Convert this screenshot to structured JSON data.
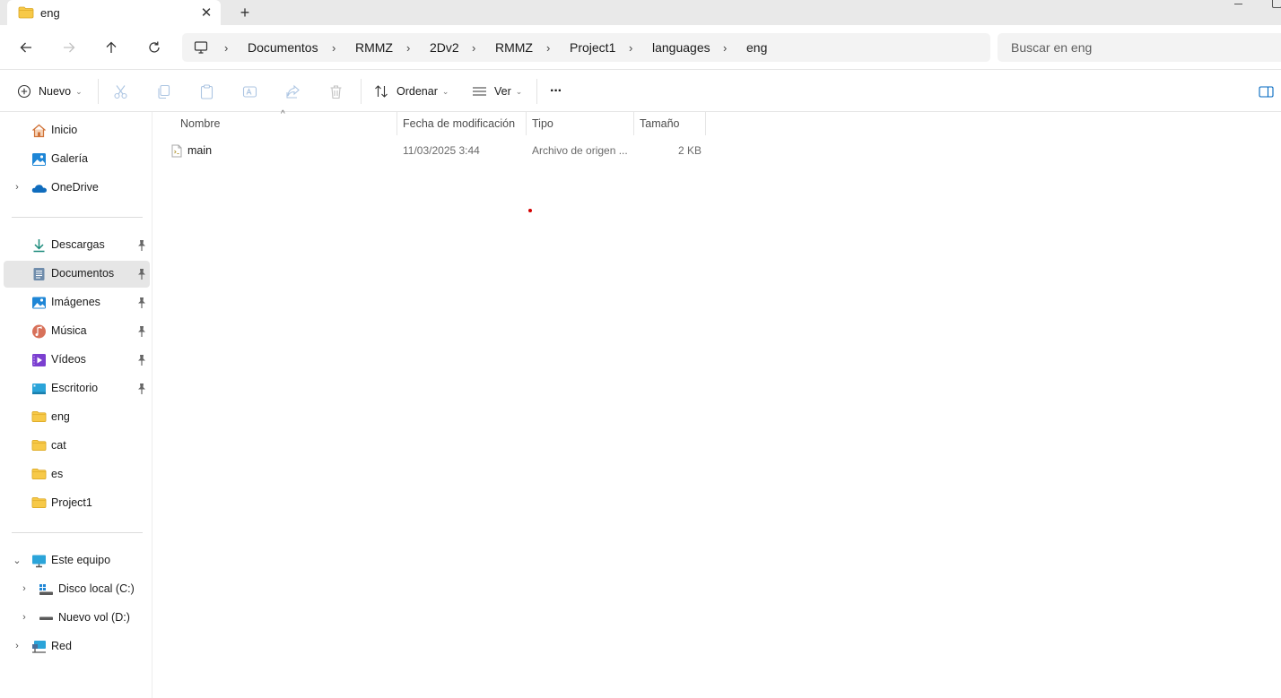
{
  "window": {
    "tab_title": "eng",
    "close_tab": "✕",
    "new_tab": "+"
  },
  "address_bar": {
    "breadcrumbs": [
      "Documentos",
      "RMMZ",
      "2Dv2",
      "RMMZ",
      "Project1",
      "languages",
      "eng"
    ],
    "separator": "›"
  },
  "search": {
    "placeholder": "Buscar en eng"
  },
  "command_bar": {
    "new_label": "Nuevo",
    "sort_label": "Ordenar",
    "view_label": "Ver",
    "more_label": "···",
    "chevron": "⌄"
  },
  "sidebar": {
    "top_items": [
      {
        "label": "Inicio",
        "icon": "home-icon"
      },
      {
        "label": "Galería",
        "icon": "gallery-icon"
      },
      {
        "label": "OneDrive",
        "icon": "onedrive-icon"
      }
    ],
    "pinned_items": [
      {
        "label": "Descargas",
        "icon": "download-icon"
      },
      {
        "label": "Documentos",
        "icon": "documents-icon",
        "selected": true
      },
      {
        "label": "Imágenes",
        "icon": "pictures-icon"
      },
      {
        "label": "Música",
        "icon": "music-icon"
      },
      {
        "label": "Vídeos",
        "icon": "videos-icon"
      },
      {
        "label": "Escritorio",
        "icon": "desktop-icon"
      },
      {
        "label": "eng",
        "icon": "folder-icon"
      },
      {
        "label": "cat",
        "icon": "folder-icon"
      },
      {
        "label": "es",
        "icon": "folder-icon"
      },
      {
        "label": "Project1",
        "icon": "folder-icon"
      }
    ],
    "pc_items": [
      {
        "label": "Este equipo",
        "icon": "pc-icon"
      },
      {
        "label": "Disco local (C:)",
        "icon": "drive-c-icon"
      },
      {
        "label": "Nuevo vol (D:)",
        "icon": "drive-d-icon"
      },
      {
        "label": "Red",
        "icon": "network-icon"
      }
    ],
    "expand_glyph": "›",
    "collapse_glyph": "⌄"
  },
  "file_list": {
    "columns": [
      "Nombre",
      "Fecha de modificación",
      "Tipo",
      "Tamaño"
    ],
    "sort_indicator": "^",
    "rows": [
      {
        "name": "main",
        "modified": "11/03/2025 3:44",
        "type": "Archivo de origen ...",
        "size": "2 KB"
      }
    ]
  },
  "colors": {
    "folder_yellow": "#f7c948",
    "selection_gray": "#e6e6e6",
    "accent_blue": "#0067c0"
  }
}
